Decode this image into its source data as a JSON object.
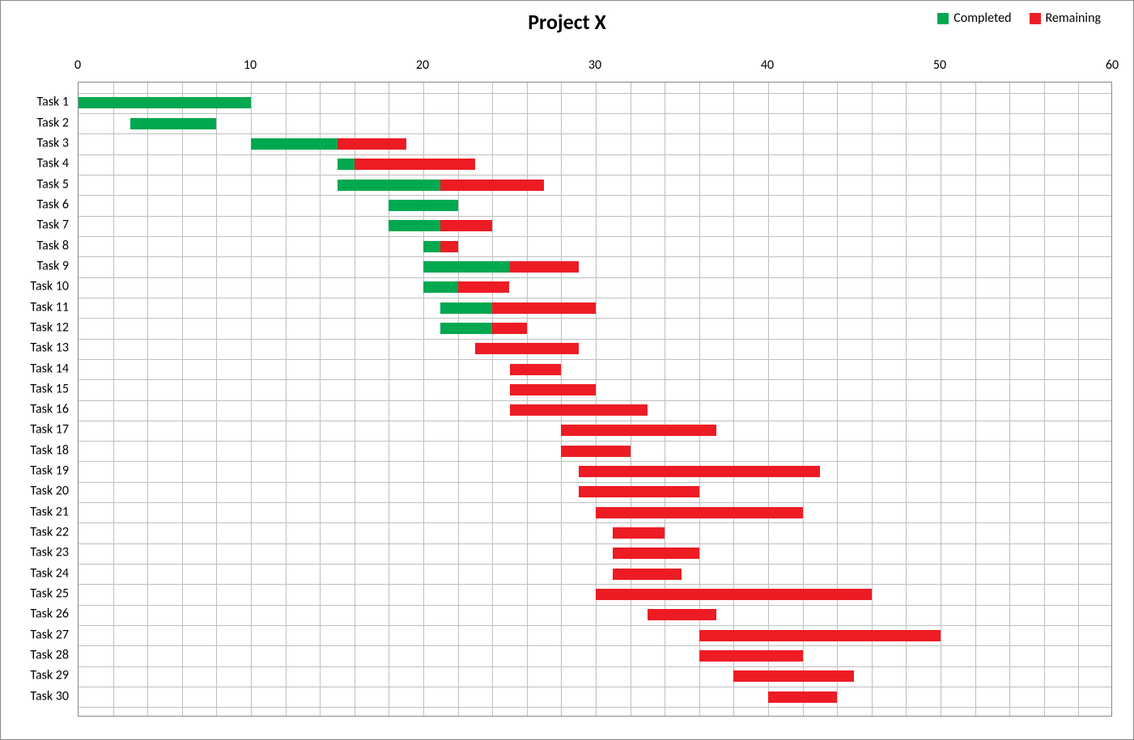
{
  "chart_data": {
    "type": "bar",
    "orientation": "horizontal",
    "stacked": true,
    "title": "Project X",
    "xlabel": "",
    "ylabel": "",
    "xlim": [
      0,
      60
    ],
    "x_ticks": [
      0,
      10,
      20,
      30,
      40,
      50,
      60
    ],
    "x_minor_interval": 2,
    "categories": [
      "Task 1",
      "Task 2",
      "Task 3",
      "Task 4",
      "Task 5",
      "Task 6",
      "Task 7",
      "Task 8",
      "Task 9",
      "Task 10",
      "Task 11",
      "Task 12",
      "Task 13",
      "Task 14",
      "Task 15",
      "Task 16",
      "Task 17",
      "Task 18",
      "Task 19",
      "Task 20",
      "Task 21",
      "Task 22",
      "Task 23",
      "Task 24",
      "Task 25",
      "Task 26",
      "Task 27",
      "Task 28",
      "Task 29",
      "Task 30"
    ],
    "series": [
      {
        "name": "Start",
        "role": "offset",
        "values": [
          0,
          3,
          10,
          15,
          15,
          18,
          18,
          20,
          20,
          20,
          21,
          21,
          23,
          25,
          25,
          25,
          28,
          28,
          29,
          29,
          30,
          31,
          31,
          31,
          30,
          33,
          36,
          36,
          38,
          40
        ]
      },
      {
        "name": "Completed",
        "color": "#00a84f",
        "values": [
          10,
          5,
          5,
          1,
          6,
          4,
          3,
          1,
          5,
          2,
          3,
          3,
          0,
          0,
          0,
          0,
          0,
          0,
          0,
          0,
          0,
          0,
          0,
          0,
          0,
          0,
          0,
          0,
          0,
          0
        ]
      },
      {
        "name": "Remaining",
        "color": "#ed1c24",
        "values": [
          0,
          0,
          4,
          7,
          6,
          0,
          3,
          1,
          4,
          3,
          6,
          2,
          6,
          3,
          5,
          8,
          9,
          4,
          14,
          7,
          12,
          3,
          5,
          4,
          16,
          4,
          14,
          6,
          7,
          4
        ]
      }
    ],
    "legend": {
      "position": "top-right",
      "entries": [
        "Completed",
        "Remaining"
      ]
    }
  }
}
